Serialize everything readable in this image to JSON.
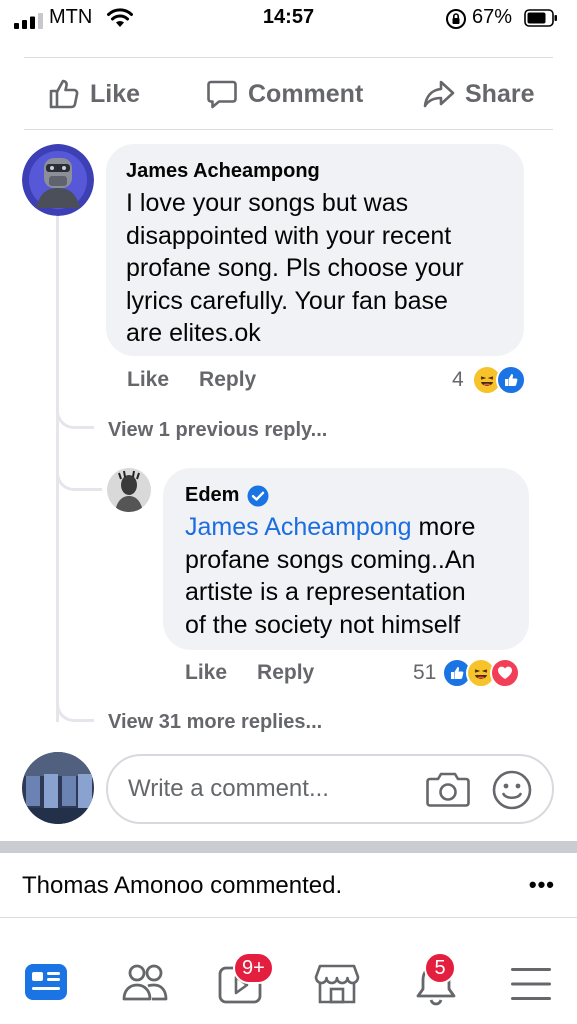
{
  "status_bar": {
    "carrier": "MTN",
    "time": "14:57",
    "battery": "67%"
  },
  "actions": {
    "like": "Like",
    "comment": "Comment",
    "share": "Share"
  },
  "comment": {
    "author": "James Acheampong",
    "lines": [
      "I love your songs but was",
      "disappointed with your recent",
      "profane song. Pls choose your",
      "lyrics carefully. Your fan base",
      "are elites.ok"
    ],
    "like_label": "Like",
    "reply_label": "Reply",
    "reaction_count": "4",
    "reactions": [
      "haha-icon",
      "like-icon"
    ]
  },
  "view_previous": "View 1 previous reply...",
  "reply": {
    "author": "Edem",
    "verified": true,
    "mention": "James Acheampong",
    "line1_rest": " more",
    "lines": [
      "profane songs coming..An",
      "artiste is a representation",
      "of the society not himself"
    ],
    "like_label": "Like",
    "reply_label": "Reply",
    "reaction_count": "51",
    "reactions": [
      "like-icon",
      "haha-icon",
      "love-icon"
    ]
  },
  "view_more": "View 31 more replies...",
  "composer": {
    "placeholder": "Write a comment..."
  },
  "notification": {
    "text": "Thomas Amonoo commented.",
    "more": "•••"
  },
  "tabs": [
    {
      "name": "news-feed-tab",
      "icon": "news-feed-icon",
      "active": true
    },
    {
      "name": "friends-tab",
      "icon": "friends-icon"
    },
    {
      "name": "watch-tab",
      "icon": "video-icon",
      "badge": "9+"
    },
    {
      "name": "marketplace-tab",
      "icon": "marketplace-icon"
    },
    {
      "name": "notifications-tab",
      "icon": "bell-icon",
      "badge": "5"
    },
    {
      "name": "menu-tab",
      "icon": "menu-icon"
    }
  ],
  "colors": {
    "accent": "#1b74e4",
    "link": "#1b6de0",
    "badge": "#e41e3f",
    "bubble": "#f0f2f5",
    "secondary_text": "#65676b"
  }
}
